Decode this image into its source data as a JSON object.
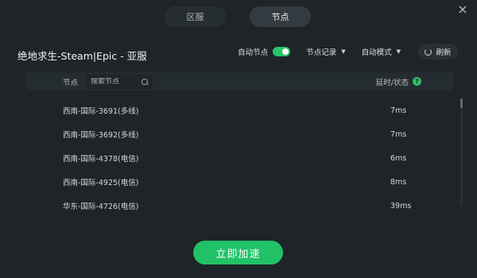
{
  "tabs": [
    {
      "label": "区服",
      "active": false
    },
    {
      "label": "节点",
      "active": true
    }
  ],
  "close_icon": "×",
  "game_title": "绝地求生-Steam|Epic - 亚服",
  "controls": {
    "auto_node_label": "自动节点",
    "auto_node_on": true,
    "node_record_label": "节点记录",
    "auto_mode_label": "自动模式",
    "refresh_label": "刷新"
  },
  "table": {
    "node_header": "节点",
    "search_placeholder": "搜索节点",
    "latency_header": "延时/状态",
    "help_icon": "?",
    "rows": [
      {
        "name": "西南-国际-3691(多线)",
        "latency": "7ms"
      },
      {
        "name": "西南-国际-3692(多线)",
        "latency": "7ms"
      },
      {
        "name": "西南-国际-4378(电信)",
        "latency": "6ms"
      },
      {
        "name": "西南-国际-4925(电信)",
        "latency": "8ms"
      },
      {
        "name": "华东-国际-4726(电信)",
        "latency": "39ms"
      }
    ]
  },
  "accelerate_label": "立即加速",
  "colors": {
    "background": "#1e2428",
    "accent": "#21c267"
  }
}
